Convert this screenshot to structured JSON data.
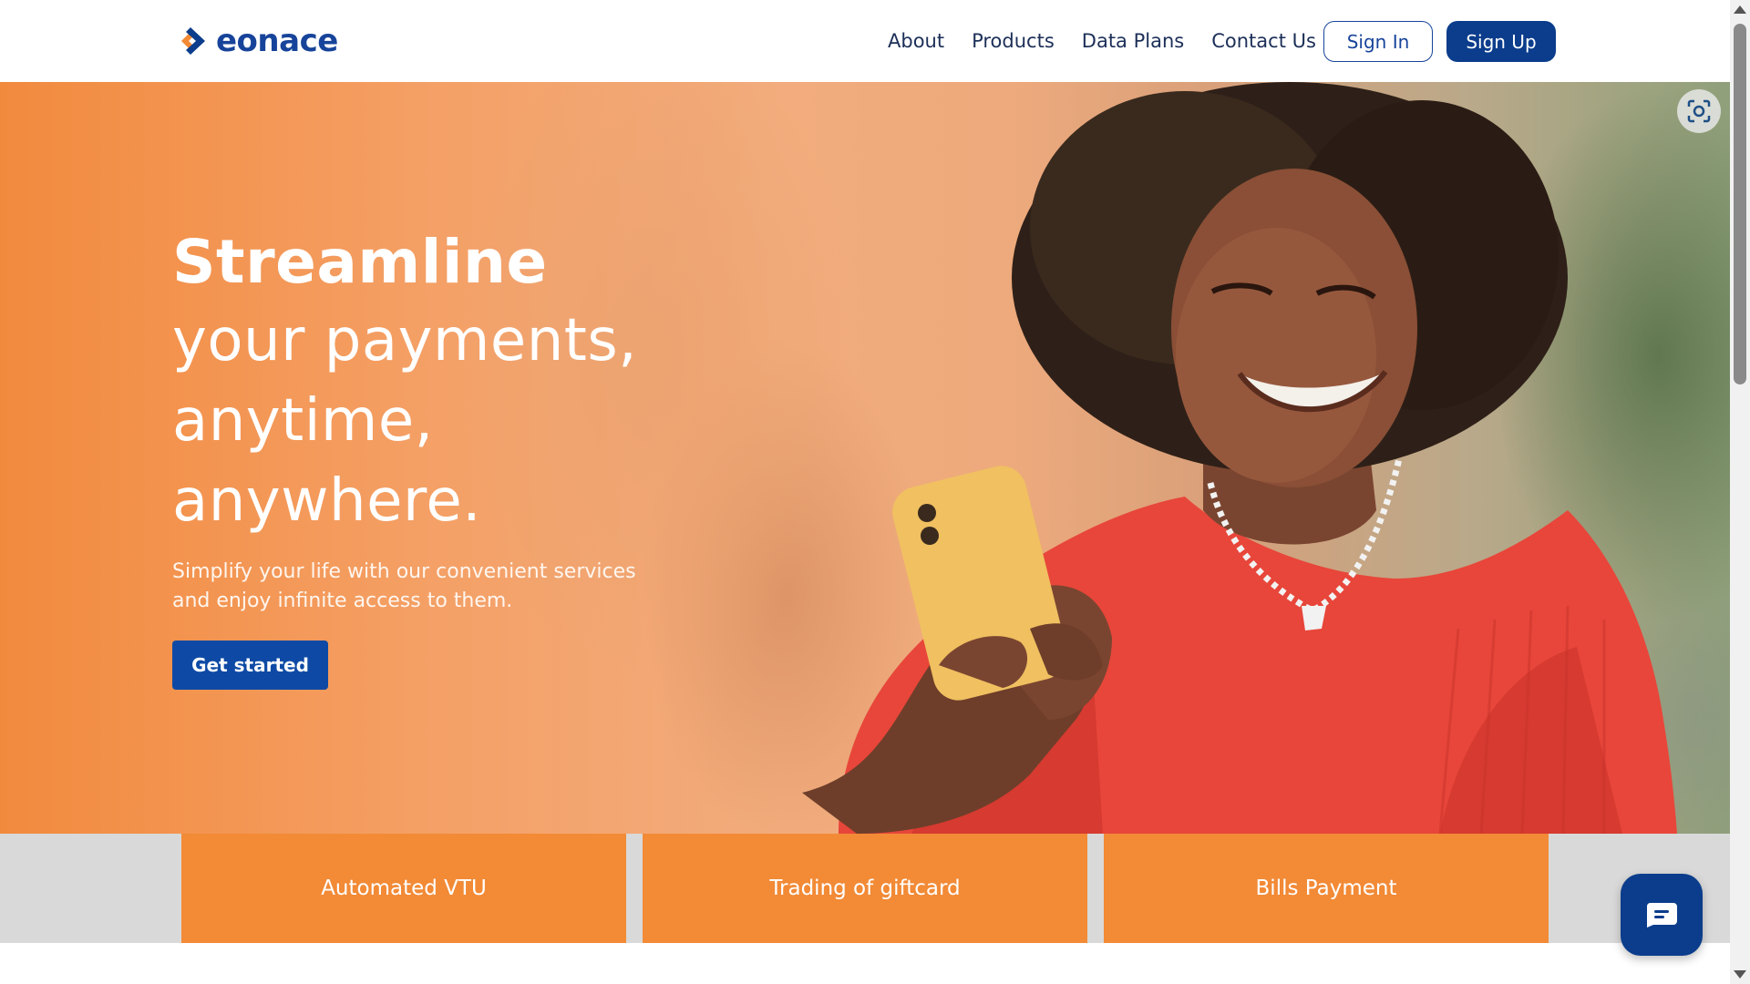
{
  "brand": {
    "name": "eonace",
    "colors": {
      "primary_blue": "#0b3d8c",
      "accent_orange": "#f28a36"
    }
  },
  "nav": {
    "items": [
      {
        "label": "About"
      },
      {
        "label": "Products"
      },
      {
        "label": "Data Plans"
      },
      {
        "label": "Contact Us"
      }
    ],
    "sign_in_label": "Sign In",
    "sign_up_label": "Sign Up"
  },
  "hero": {
    "title_strong": "Streamline",
    "title_lines": [
      "your payments,",
      "anytime,",
      "anywhere."
    ],
    "subtitle": "Simplify your life with our convenient services and enjoy infinite access to them.",
    "cta_label": "Get started"
  },
  "services": [
    {
      "label": "Automated VTU"
    },
    {
      "label": "Trading of giftcard"
    },
    {
      "label": "Bills Payment"
    }
  ],
  "icons": {
    "logo": "eonace-logo-mark",
    "scan": "scan-icon",
    "chat": "chat-icon"
  }
}
